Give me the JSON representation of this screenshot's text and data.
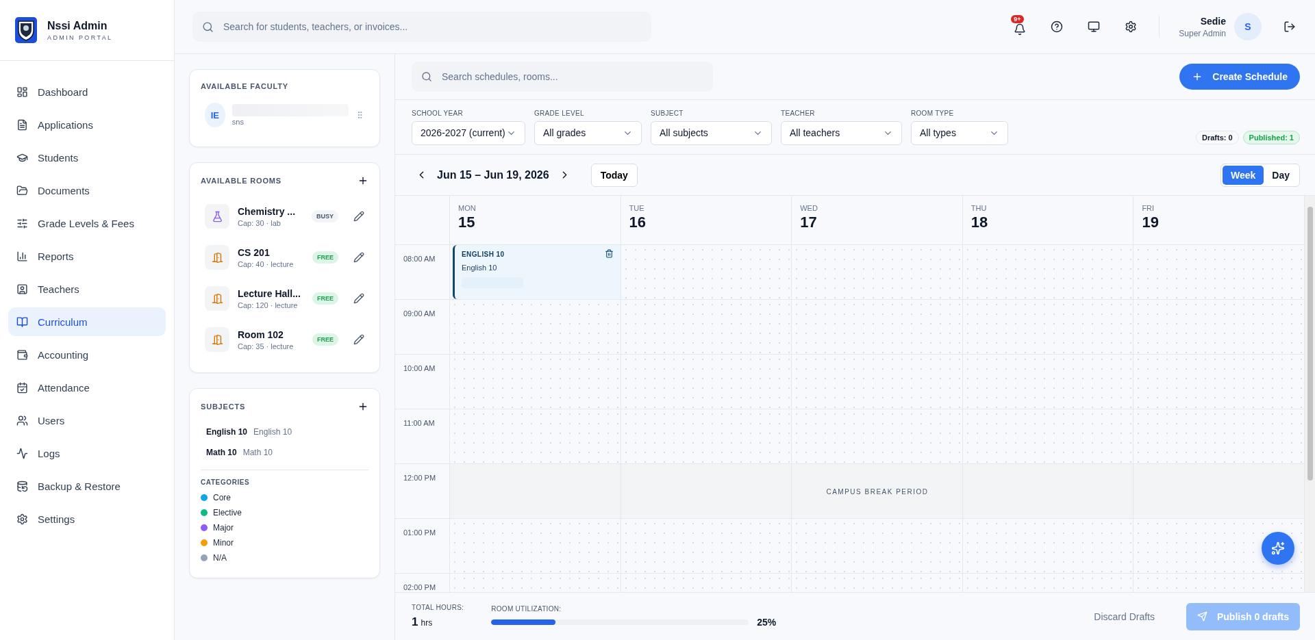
{
  "brand": {
    "title": "Nssi Admin",
    "subtitle": "ADMIN PORTAL"
  },
  "sidebar": {
    "items": [
      {
        "label": "Dashboard",
        "selected": false
      },
      {
        "label": "Applications",
        "selected": false
      },
      {
        "label": "Students",
        "selected": false
      },
      {
        "label": "Documents",
        "selected": false
      },
      {
        "label": "Grade Levels & Fees",
        "selected": false
      },
      {
        "label": "Reports",
        "selected": false
      },
      {
        "label": "Teachers",
        "selected": false
      },
      {
        "label": "Curriculum",
        "selected": true
      },
      {
        "label": "Accounting",
        "selected": false
      },
      {
        "label": "Attendance",
        "selected": false
      },
      {
        "label": "Users",
        "selected": false
      },
      {
        "label": "Logs",
        "selected": false
      },
      {
        "label": "Backup & Restore",
        "selected": false
      },
      {
        "label": "Settings",
        "selected": false
      }
    ]
  },
  "header": {
    "search": {
      "placeholder": "Search for students, teachers, or invoices..."
    },
    "notification_badge": "9+",
    "user": {
      "name": "Sedie",
      "role": "Super Admin",
      "initial": "S"
    }
  },
  "faculty": {
    "title": "AVAILABLE FACULTY",
    "items": [
      {
        "initials": "IE",
        "subtitle": "sns"
      }
    ]
  },
  "rooms": {
    "title": "AVAILABLE ROOMS",
    "items": [
      {
        "name": "Chemistry ...",
        "detail": "Cap: 30 · lab",
        "kind": "lab",
        "status": "BUSY",
        "available": false
      },
      {
        "name": "CS 201",
        "detail": "Cap: 40 · lecture",
        "kind": "lecture",
        "status": "FREE",
        "available": true
      },
      {
        "name": "Lecture Hall...",
        "detail": "Cap: 120 · lecture",
        "kind": "lecture",
        "status": "FREE",
        "available": true
      },
      {
        "name": "Room 102",
        "detail": "Cap: 35 · lecture",
        "kind": "lecture",
        "status": "FREE",
        "available": true
      }
    ]
  },
  "subjects": {
    "title": "SUBJECTS",
    "items": [
      {
        "name": "English 10",
        "description": "English 10"
      },
      {
        "name": "Math 10",
        "description": "Math 10"
      }
    ],
    "categories_title": "CATEGORIES",
    "categories": [
      {
        "label": "Core",
        "color": "#0ea5e9"
      },
      {
        "label": "Elective",
        "color": "#10b981"
      },
      {
        "label": "Major",
        "color": "#8b5cf6"
      },
      {
        "label": "Minor",
        "color": "#f59e0b"
      },
      {
        "label": "N/A",
        "color": "#94a3b8"
      }
    ]
  },
  "scheduler": {
    "search": {
      "placeholder": "Search schedules, rooms..."
    },
    "create_button": "Create Schedule",
    "filters": [
      {
        "label": "SCHOOL YEAR",
        "value": "2026-2027 (current)"
      },
      {
        "label": "GRADE LEVEL",
        "value": "All grades"
      },
      {
        "label": "SUBJECT",
        "value": "All subjects"
      },
      {
        "label": "TEACHER",
        "value": "All teachers"
      },
      {
        "label": "ROOM TYPE",
        "value": "All types"
      }
    ],
    "drafts": "Drafts: 0",
    "published": "Published: 1",
    "range": "Jun 15 – Jun 19, 2026",
    "today_button": "Today",
    "views": [
      {
        "label": "Week",
        "selected": true
      },
      {
        "label": "Day",
        "selected": false
      }
    ],
    "days": [
      {
        "name": "MON",
        "date": "15"
      },
      {
        "name": "TUE",
        "date": "16"
      },
      {
        "name": "WED",
        "date": "17"
      },
      {
        "name": "THU",
        "date": "18"
      },
      {
        "name": "FRI",
        "date": "19"
      }
    ],
    "rows": [
      {
        "time": "08:00 AM",
        "kind": "slot",
        "cells": [
          {
            "code": "ENGLISH 10",
            "title": "English 10"
          },
          null,
          null,
          null,
          null
        ]
      },
      {
        "time": "09:00 AM",
        "kind": "slot",
        "cells": [
          null,
          null,
          null,
          null,
          null
        ]
      },
      {
        "time": "10:00 AM",
        "kind": "slot",
        "cells": [
          null,
          null,
          null,
          null,
          null
        ]
      },
      {
        "time": "11:00 AM",
        "kind": "slot",
        "cells": [
          null,
          null,
          null,
          null,
          null
        ]
      },
      {
        "time": "12:00 PM",
        "kind": "break",
        "label": "CAMPUS BREAK PERIOD"
      },
      {
        "time": "01:00 PM",
        "kind": "slot",
        "cells": [
          null,
          null,
          null,
          null,
          null
        ]
      },
      {
        "time": "02:00 PM",
        "kind": "slot",
        "cells": [
          null,
          null,
          null,
          null,
          null
        ]
      }
    ],
    "footer": {
      "hours_label": "TOTAL HOURS:",
      "hours_value": "1",
      "hours_unit": "hrs",
      "utilization_label": "ROOM UTILIZATION:",
      "level": 0.25,
      "utilization_value": "25%",
      "discard_button": "Discard Drafts",
      "publish_button": "Publish 0 drafts"
    }
  }
}
